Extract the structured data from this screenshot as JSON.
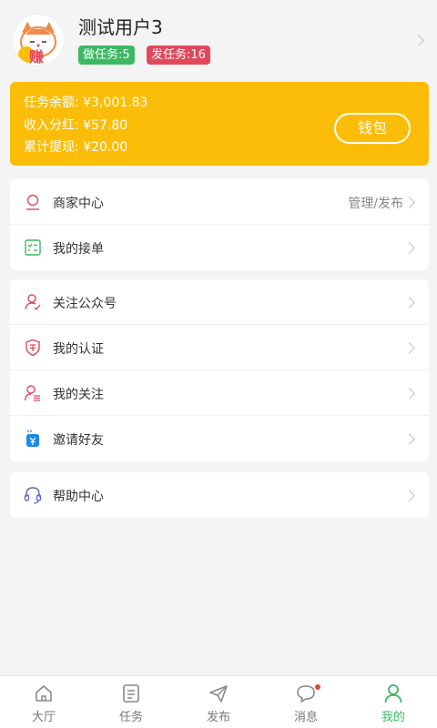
{
  "profile": {
    "username": "测试用户3",
    "badge_do": "做任务:5",
    "badge_post": "发任务:16",
    "avatar_char": "赚"
  },
  "wallet": {
    "balance": "任务余额: ¥3,001.83",
    "income": "收入分红: ¥57.80",
    "withdrawn": "累计提现: ¥20.00",
    "button": "钱包"
  },
  "menu1": [
    {
      "label": "商家中心",
      "extra": "管理/发布",
      "icon": "merchant-icon"
    },
    {
      "label": "我的接单",
      "icon": "order-list-icon"
    }
  ],
  "menu2": [
    {
      "label": "关注公众号",
      "icon": "follow-user-icon"
    },
    {
      "label": "我的认证",
      "icon": "shield-icon"
    },
    {
      "label": "我的关注",
      "icon": "user-list-icon"
    },
    {
      "label": "邀请好友",
      "icon": "invite-icon"
    }
  ],
  "menu3": [
    {
      "label": "帮助中心",
      "icon": "headset-icon"
    }
  ],
  "tabs": [
    {
      "label": "大厅",
      "icon": "home-icon"
    },
    {
      "label": "任务",
      "icon": "task-icon"
    },
    {
      "label": "发布",
      "icon": "send-icon"
    },
    {
      "label": "消息",
      "icon": "message-icon"
    },
    {
      "label": "我的",
      "icon": "user-icon"
    }
  ],
  "colors": {
    "accent": "#3cb962",
    "wallet": "#fcbd08",
    "badge_red": "#e1495b"
  }
}
